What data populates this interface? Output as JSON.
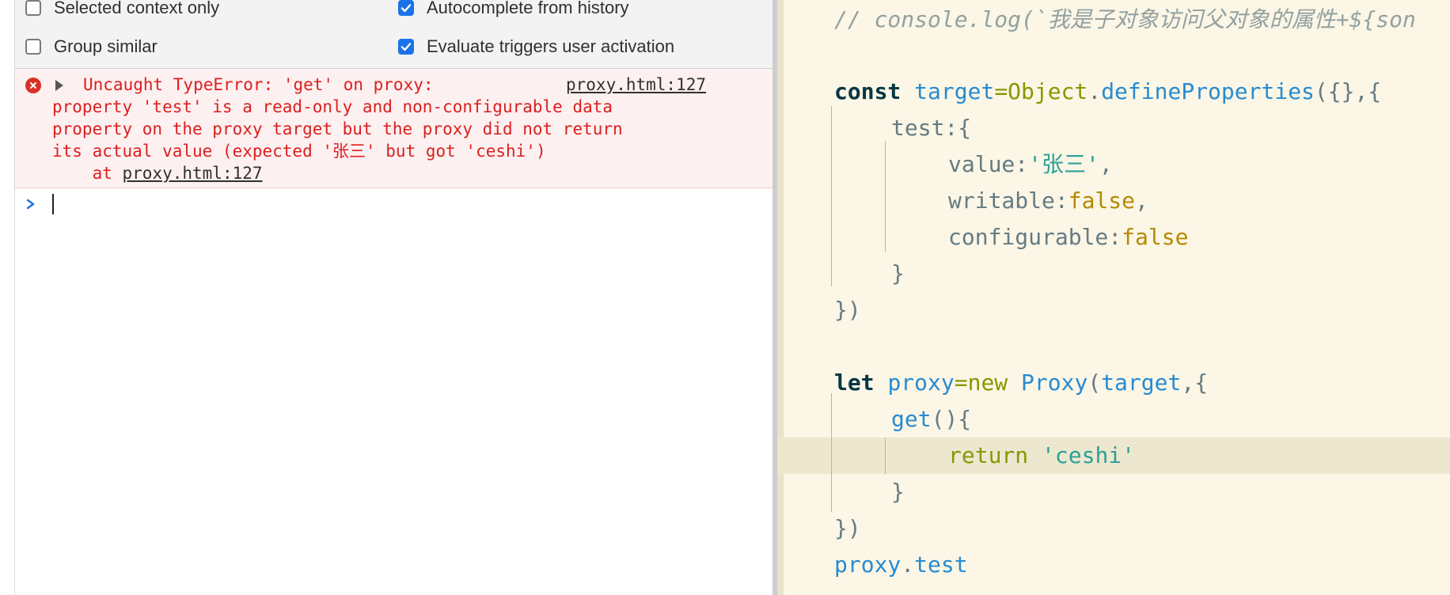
{
  "console": {
    "settings": {
      "selected_context_only": {
        "label": "Selected context only",
        "checked": false
      },
      "autocomplete_from_history": {
        "label": "Autocomplete from history",
        "checked": true
      },
      "group_similar": {
        "label": "Group similar",
        "checked": false
      },
      "evaluate_triggers": {
        "label": "Evaluate triggers user activation",
        "checked": true
      }
    },
    "error": {
      "line1": "Uncaught TypeError: 'get' on proxy:",
      "line2": "property 'test' is a read-only and non-configurable data",
      "line3": "property on the proxy target but the proxy did not return",
      "line4": "its actual value (expected '张三' but got 'ceshi')",
      "at_word": "    at ",
      "at_link": "proxy.html:127",
      "source_link": "proxy.html:127"
    },
    "prompt_symbol": ">"
  },
  "editor": {
    "line_comment": "// console.log(`我是子对象访问父对象的属性+${son",
    "l_const_kw": "const",
    "l_const_var": "target",
    "l_const_op": "=",
    "l_const_obj": "Object",
    "l_const_dot": ".",
    "l_const_fn": "defineProperties",
    "l_const_rest": "({},{",
    "l_test": "test:{",
    "l_value_key": "value:",
    "l_value_str": "'张三'",
    "l_value_comma": ",",
    "l_writable_key": "writable:",
    "l_writable_val": "false",
    "l_writable_comma": ",",
    "l_config_key": "configurable:",
    "l_config_val": "false",
    "l_close_inner": "}",
    "l_close_outer": "})",
    "l_let_kw": "let",
    "l_let_var": "proxy",
    "l_let_op": "=",
    "l_let_new": "new",
    "l_let_cls": "Proxy",
    "l_let_paren": "(",
    "l_let_arg": "target",
    "l_let_rest": ",{",
    "l_get_fn": "get",
    "l_get_rest": "(){",
    "l_return_kw": "return",
    "l_return_str": "'ceshi'",
    "l_close_get": "}",
    "l_close_proxy": "})",
    "l_proxy_obj": "proxy",
    "l_proxy_dot": ".",
    "l_proxy_prop": "test"
  },
  "colors": {
    "error_text": "#dc1f1f",
    "checkbox_checked": "#1a73e8",
    "editor_bg": "#fbf6e5"
  }
}
